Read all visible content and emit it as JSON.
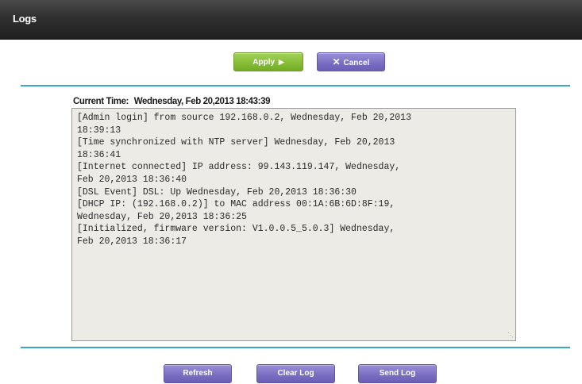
{
  "window": {
    "title": "Logs"
  },
  "actions": {
    "apply_label": "Apply",
    "apply_icon": "play-arrow-icon",
    "cancel_label": "Cancel",
    "cancel_icon": "x-icon"
  },
  "log": {
    "current_time_label": "Current Time:",
    "current_time_value": "Wednesday, Feb 20,2013 18:43:39",
    "content": "[Admin login] from source 192.168.0.2, Wednesday, Feb 20,2013\n18:39:13\n[Time synchronized with NTP server] Wednesday, Feb 20,2013\n18:36:41\n[Internet connected] IP address: 99.143.119.147, Wednesday,\nFeb 20,2013 18:36:40\n[DSL Event] DSL: Up Wednesday, Feb 20,2013 18:36:30\n[DHCP IP: (192.168.0.2)] to MAC address 00:1A:6B:6D:8F:19,\nWednesday, Feb 20,2013 18:36:25\n[Initialized, firmware version: V1.0.0.5_5.0.3] Wednesday,\nFeb 20,2013 18:36:17"
  },
  "footer": {
    "refresh_label": "Refresh",
    "clear_log_label": "Clear Log",
    "send_log_label": "Send Log"
  },
  "colors": {
    "title_bar": "#2f2f2f",
    "apply_button": "#86be36",
    "purple_button": "#7b6fc4",
    "divider": "#3ba6c8",
    "log_background": "#ecebe6"
  }
}
